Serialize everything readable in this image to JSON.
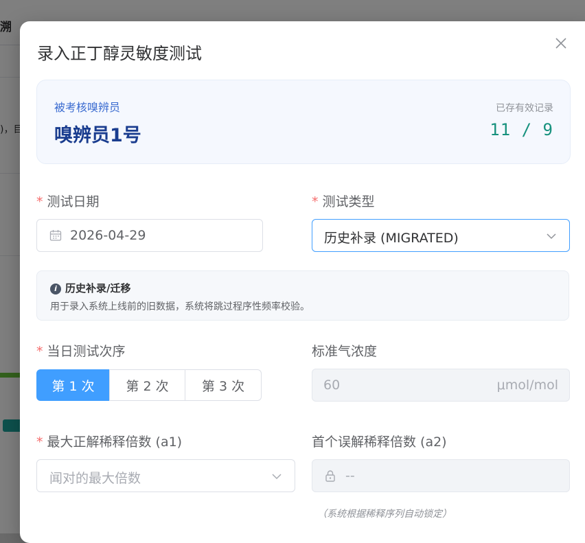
{
  "background": {
    "tab_fragment": "溯",
    "text_fragment": ")，目"
  },
  "dialog": {
    "title": "录入正丁醇灵敏度测试",
    "close_icon": "close-icon"
  },
  "examinee": {
    "label": "被考核嗅辨员",
    "name": "嗅辨员1号",
    "records_label": "已存有效记录",
    "records_value": "11 / 9"
  },
  "test_date": {
    "label": "测试日期",
    "value": "2026-04-29",
    "icon": "calendar-icon"
  },
  "test_type": {
    "label": "测试类型",
    "value": "历史补录 (MIGRATED)",
    "icon": "chevron-down-icon"
  },
  "info": {
    "title": "历史补录/迁移",
    "description": "用于录入系统上线前的旧数据，系统将跳过程序性频率校验。",
    "icon": "info-icon"
  },
  "sequence": {
    "label": "当日测试次序",
    "options": [
      "第 1 次",
      "第 2 次",
      "第 3 次"
    ],
    "selected": "第 1 次"
  },
  "standard_gas": {
    "label": "标准气浓度",
    "value": "60",
    "unit": "μmol/mol"
  },
  "max_dilution": {
    "label": "最大正解稀释倍数 (a1)",
    "placeholder": "闻对的最大倍数"
  },
  "first_wrong": {
    "label": "首个误解稀释倍数 (a2)",
    "value": "--",
    "hint": "（系统根据稀释序列自动锁定）"
  },
  "colors": {
    "primary": "#409eff",
    "required": "#f56c6c",
    "examinee_name": "#1a3d8f",
    "records_value": "#16917d"
  }
}
